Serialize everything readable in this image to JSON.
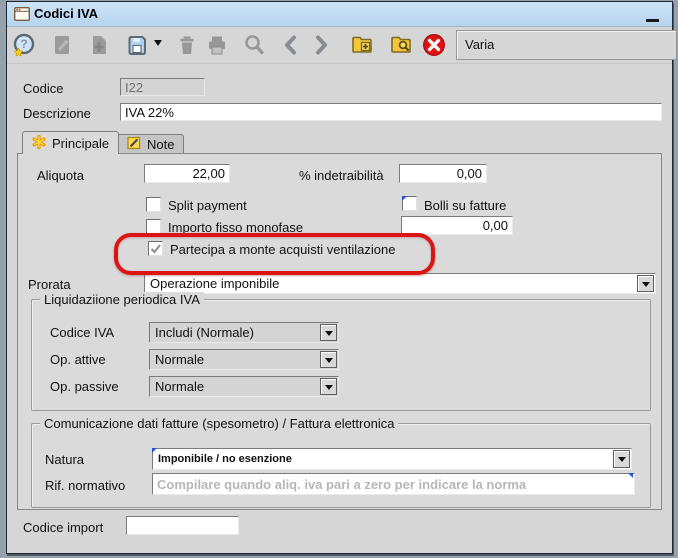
{
  "window": {
    "title": "Codici IVA"
  },
  "toolbar": {
    "varia_label": "Varia",
    "icons": [
      "help",
      "edit-document",
      "new-document",
      "save",
      "save-menu-caret",
      "delete",
      "print",
      "search",
      "previous",
      "next",
      "new-folder",
      "find-folder",
      "close"
    ]
  },
  "header_fields": {
    "codice": {
      "label": "Codice",
      "value": "I22"
    },
    "descrizione": {
      "label": "Descrizione",
      "value": "IVA 22%"
    }
  },
  "tabs": [
    {
      "label": "Principale",
      "icon": "asterisk-icon",
      "selected": true
    },
    {
      "label": "Note",
      "icon": "note-icon",
      "selected": false
    }
  ],
  "principale": {
    "aliquota": {
      "label": "Aliquota",
      "value": "22,00"
    },
    "indetraibilita": {
      "label": "% indetraibilità",
      "value": "0,00"
    },
    "split_payment": {
      "label": "Split payment",
      "checked": false
    },
    "bolli_su_fatture": {
      "label": "Bolli su fatture",
      "checked": false
    },
    "importo_fisso_monofase": {
      "label": "Importo fisso monofase",
      "checked": false,
      "value": "0,00"
    },
    "partecipa_ventilazione": {
      "label": "Partecipa a monte acquisti ventilazione",
      "checked": true,
      "highlighted": true
    },
    "prorata": {
      "label": "Prorata",
      "value": "Operazione imponibile"
    },
    "liquidazione_group": {
      "title": "Liquidaziione periodica IVA",
      "codice_iva": {
        "label": "Codice IVA",
        "value": "Includi (Normale)"
      },
      "op_attive": {
        "label": "Op. attive",
        "value": "Normale"
      },
      "op_passive": {
        "label": "Op. passive",
        "value": "Normale"
      }
    },
    "comunicazione_group": {
      "title": "Comunicazione dati fatture (spesometro) / Fattura elettronica",
      "natura": {
        "label": "Natura",
        "value": "Imponibile / no esenzione"
      },
      "rif_normativo": {
        "label": "Rif. normativo",
        "value": "",
        "placeholder": "Compilare quando aliq. iva pari a zero per indicare la norma"
      }
    }
  },
  "footer": {
    "codice_import": {
      "label": "Codice import",
      "value": ""
    }
  },
  "colors": {
    "titlebar_blue": "#c3ddf3",
    "annotation_red": "#dc1414",
    "folder_yellow": "#f6c63a",
    "close_red": "#e01313",
    "save_blue": "#aed2ef",
    "window_bg": "#d6d6d6"
  }
}
